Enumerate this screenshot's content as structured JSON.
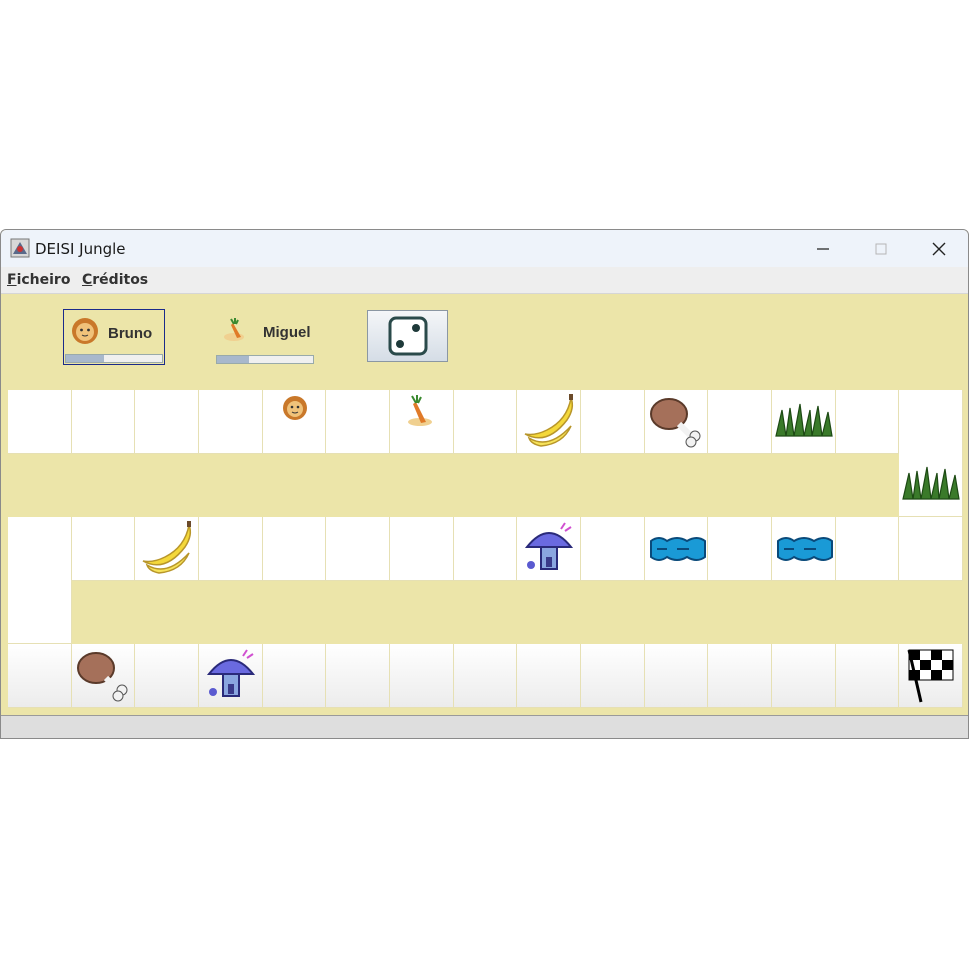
{
  "window": {
    "title": "DEISI Jungle"
  },
  "menu": {
    "items": [
      "Ficheiro",
      "Créditos"
    ]
  },
  "players": [
    {
      "name": "Bruno",
      "icon": "lion-icon",
      "energy_percent": 40,
      "active": true
    },
    {
      "name": "Miguel",
      "icon": "bird-icon",
      "energy_percent": 33,
      "active": false
    }
  ],
  "dice": {
    "face": 2,
    "icon": "dice-icon"
  },
  "board": {
    "rows": [
      [
        "",
        "",
        "",
        "",
        "lion",
        "",
        "bird",
        "",
        "banana",
        "",
        "meat",
        "",
        "grass",
        "",
        ""
      ],
      [
        "",
        "",
        "",
        "",
        "",
        "",
        "",
        "",
        "",
        "",
        "",
        "",
        "",
        "",
        "grass"
      ],
      [
        "",
        "",
        "banana",
        "",
        "",
        "",
        "",
        "",
        "mushroom",
        "",
        "water",
        "",
        "water",
        "",
        ""
      ],
      [
        "",
        "",
        "",
        "",
        "",
        "",
        "",
        "",
        "",
        "",
        "",
        "",
        "",
        "",
        ""
      ],
      [
        "",
        "meat",
        "",
        "mushroom",
        "",
        "",
        "",
        "",
        "",
        "",
        "",
        "",
        "",
        "",
        "flag"
      ]
    ]
  },
  "colors": {
    "background": "#ece5a9",
    "cell": "#ffffff",
    "active_border": "#1a2a8a"
  }
}
